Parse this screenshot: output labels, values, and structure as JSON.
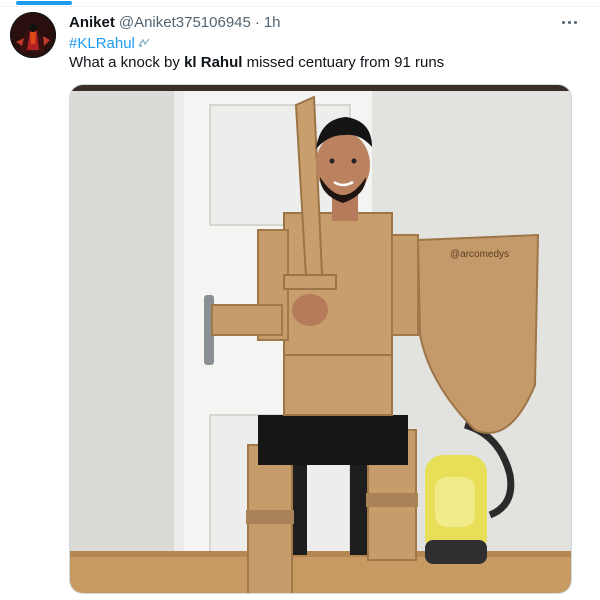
{
  "author": {
    "display_name": "Aniket",
    "handle": "@Aniket375106945",
    "separator": "·",
    "timestamp": "1h"
  },
  "tweet": {
    "hashtag": "#KLRahul",
    "text_before": "What a knock by ",
    "text_bold": "kl Rahul",
    "text_after": " missed centuary from 91 runs"
  },
  "media": {
    "watermark": "@arcomedys"
  },
  "icons": {
    "more": "more-horizontal-icon",
    "avatar": "user-avatar-image",
    "emoji": "hashtag-emoji-icon"
  },
  "colors": {
    "accent": "#1d9bf0",
    "text_primary": "#0f1419",
    "text_secondary": "#536471"
  }
}
